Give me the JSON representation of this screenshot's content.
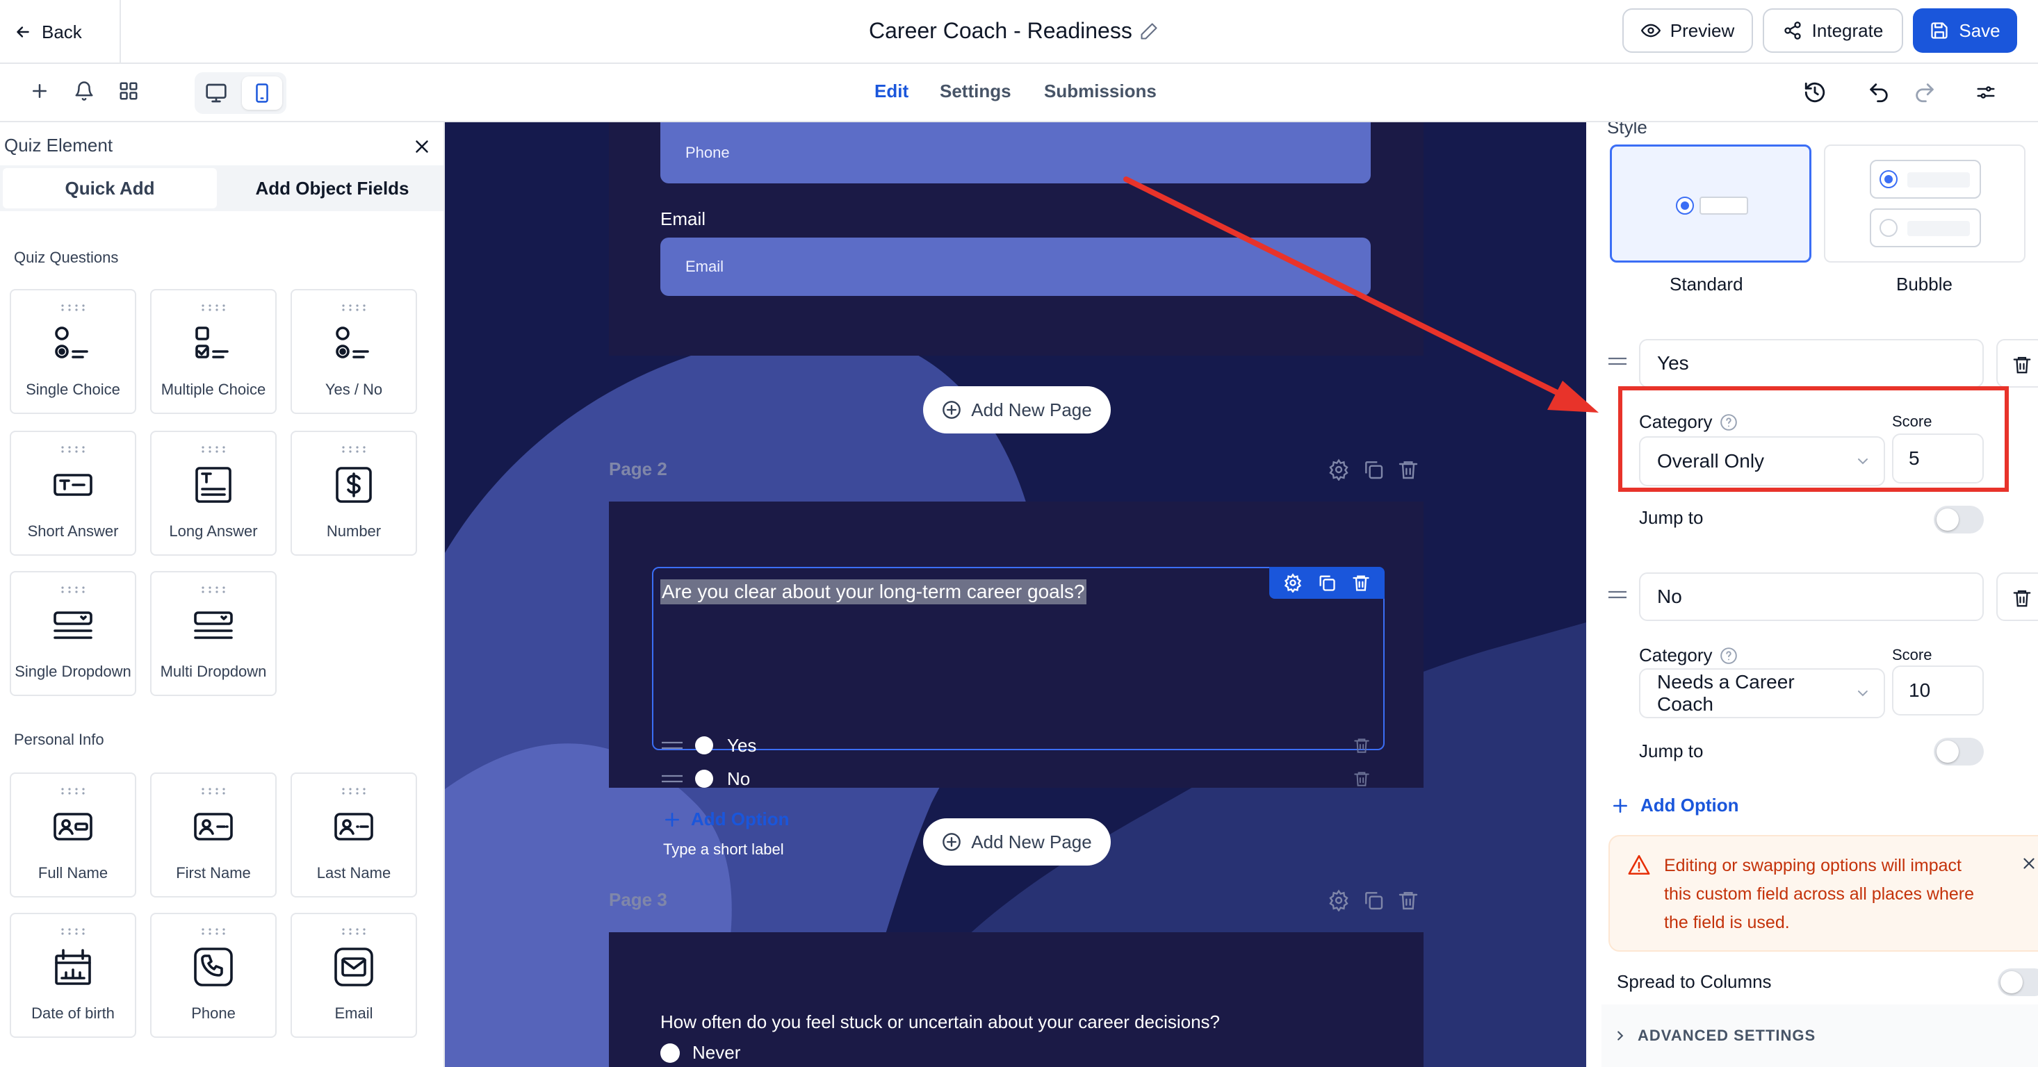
{
  "header": {
    "back_label": "Back",
    "title": "Career Coach - Readiness",
    "preview_label": "Preview",
    "integrate_label": "Integrate",
    "save_label": "Save"
  },
  "nav": {
    "tabs": [
      {
        "label": "Edit",
        "active": true
      },
      {
        "label": "Settings",
        "active": false
      },
      {
        "label": "Submissions",
        "active": false
      }
    ]
  },
  "left_panel": {
    "title": "Quiz Element",
    "tabs": [
      "Quick Add",
      "Add Object Fields"
    ],
    "quiz_section_title": "Quiz Questions",
    "quiz_items": [
      {
        "label": "Single Choice",
        "icon": "single-choice-icon"
      },
      {
        "label": "Multiple Choice",
        "icon": "multiple-choice-icon"
      },
      {
        "label": "Yes / No",
        "icon": "yes-no-icon"
      },
      {
        "label": "Short Answer",
        "icon": "short-answer-icon"
      },
      {
        "label": "Long Answer",
        "icon": "long-answer-icon"
      },
      {
        "label": "Number",
        "icon": "dollar-icon"
      },
      {
        "label": "Single Dropdown",
        "icon": "dropdown-icon"
      },
      {
        "label": "Multi Dropdown",
        "icon": "dropdown-icon"
      }
    ],
    "personal_section_title": "Personal Info",
    "personal_items": [
      {
        "label": "Full Name",
        "icon": "id-card-icon"
      },
      {
        "label": "First Name",
        "icon": "id-card-icon"
      },
      {
        "label": "Last Name",
        "icon": "id-card-icon"
      },
      {
        "label": "Date of birth",
        "icon": "cake-icon"
      },
      {
        "label": "Phone",
        "icon": "phone-icon"
      },
      {
        "label": "Email",
        "icon": "mail-icon"
      }
    ]
  },
  "canvas": {
    "phone_placeholder": "Phone",
    "email_label": "Email",
    "email_placeholder": "Email",
    "add_page_label": "Add New Page",
    "page2_label": "Page 2",
    "question": "Are you clear about your long-term career goals?",
    "options": [
      "Yes",
      "No"
    ],
    "add_option_label": "Add Option",
    "hint": "Type a short label",
    "page3_label": "Page 3",
    "question3": "How often do you feel stuck or uncertain about your career decisions?",
    "question3_option": "Never"
  },
  "right_panel": {
    "style_label": "Style",
    "style_options": [
      "Standard",
      "Bubble"
    ],
    "selected_style": "Standard",
    "options": [
      {
        "value": "Yes",
        "category_label": "Category",
        "category": "Overall Only",
        "score_label": "Score",
        "score": "5",
        "jump_label": "Jump to",
        "jump_enabled": false
      },
      {
        "value": "No",
        "category_label": "Category",
        "category": "Needs a Career Coach",
        "score_label": "Score",
        "score": "10",
        "jump_label": "Jump to",
        "jump_enabled": false
      }
    ],
    "add_option_label": "Add Option",
    "warning_text": "Editing or swapping options will impact this custom field across all places where the field is used.",
    "spread_label": "Spread to Columns",
    "spread_enabled": false,
    "advanced_label": "ADVANCED SETTINGS"
  },
  "colors": {
    "brand_blue": "#1a56db",
    "canvas_bg": "#151a4d",
    "form_card": "#1b1a46",
    "input_fill": "#5c6dc7",
    "annotation_red": "#e8332a",
    "warning_text": "#c4320a",
    "warning_bg": "#fef6ee"
  }
}
